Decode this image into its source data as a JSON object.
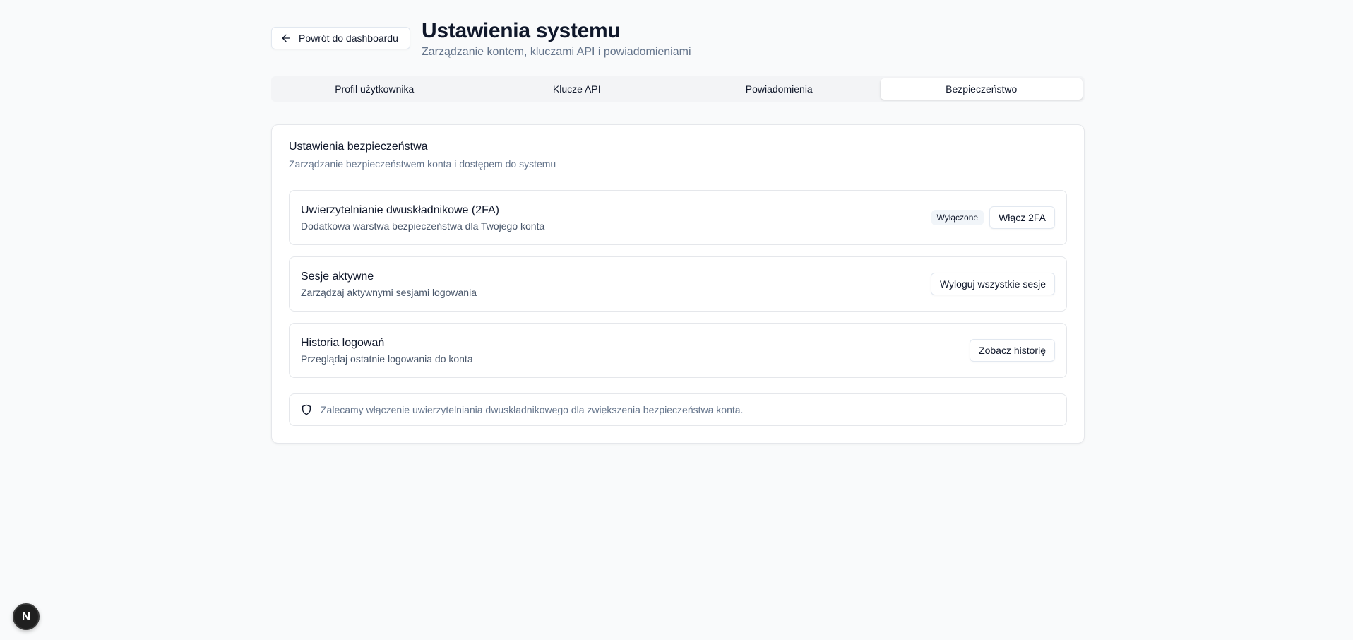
{
  "header": {
    "back_label": "Powrót do dashboardu",
    "title": "Ustawienia systemu",
    "subtitle": "Zarządzanie kontem, kluczami API i powiadomieniami"
  },
  "tabs": [
    {
      "label": "Profil użytkownika",
      "active": false
    },
    {
      "label": "Klucze API",
      "active": false
    },
    {
      "label": "Powiadomienia",
      "active": false
    },
    {
      "label": "Bezpieczeństwo",
      "active": true
    }
  ],
  "security": {
    "title": "Ustawienia bezpieczeństwa",
    "description": "Zarządzanie bezpieczeństwem konta i dostępem do systemu",
    "settings": [
      {
        "title": "Uwierzytelnianie dwuskładnikowe (2FA)",
        "description": "Dodatkowa warstwa bezpieczeństwa dla Twojego konta",
        "badge": "Wyłączone",
        "button": "Włącz 2FA"
      },
      {
        "title": "Sesje aktywne",
        "description": "Zarządzaj aktywnymi sesjami logowania",
        "button": "Wyloguj wszystkie sesje"
      },
      {
        "title": "Historia logowań",
        "description": "Przeglądaj ostatnie logowania do konta",
        "button": "Zobacz historię"
      }
    ],
    "notice": "Zalecamy włączenie uwierzytelniania dwuskładnikowego dla zwiększenia bezpieczeństwa konta."
  },
  "dev_badge": {
    "label": "N"
  },
  "icons": {
    "back": "arrow-left-icon",
    "notice": "shield-icon"
  }
}
